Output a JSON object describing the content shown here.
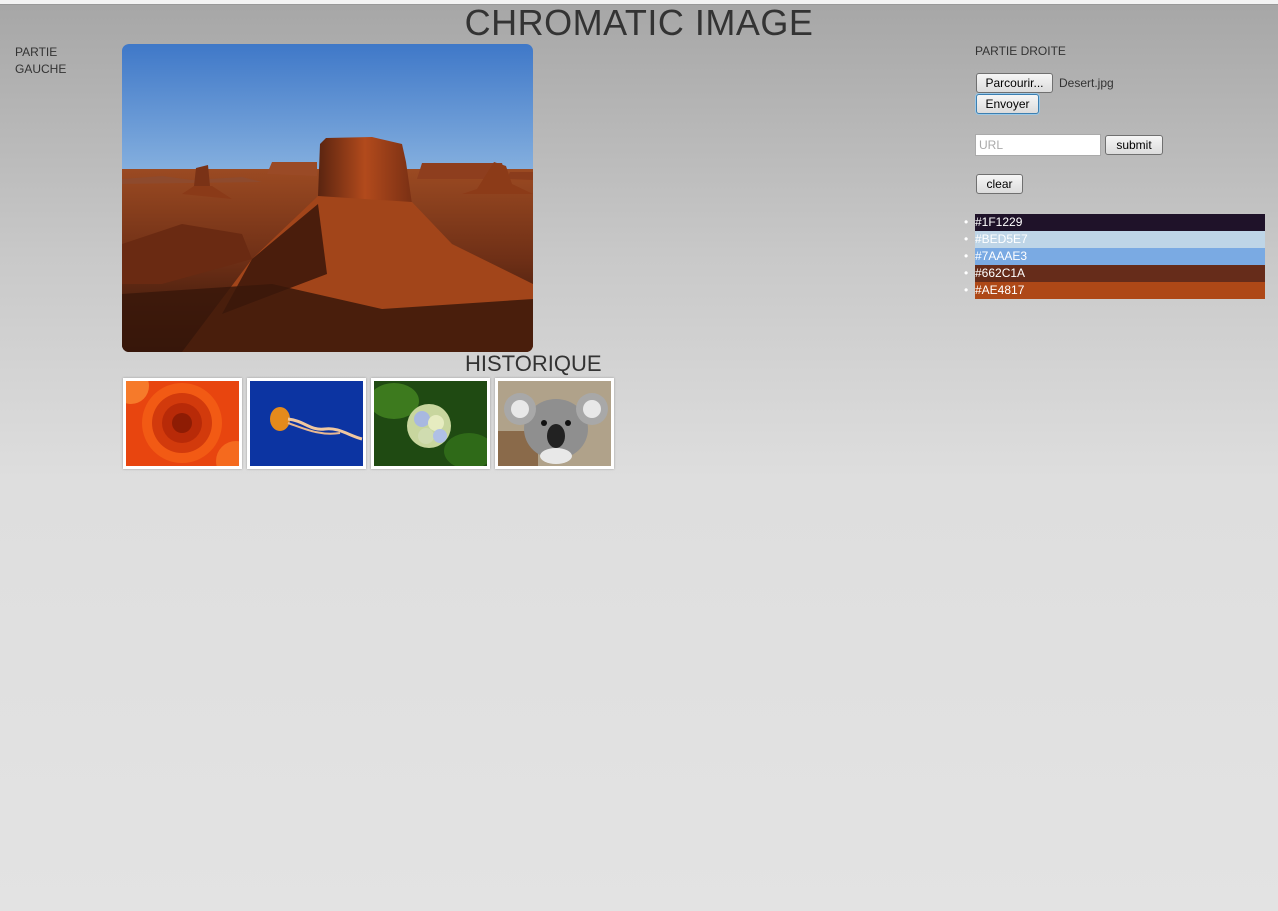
{
  "header": {
    "title": "CHROMATIC IMAGE"
  },
  "left_panel": {
    "label": "PARTIE GAUCHE"
  },
  "right_panel": {
    "label": "PARTIE DROITE",
    "browse_label": "Parcourir...",
    "file_name": "Desert.jpg",
    "send_label": "Envoyer",
    "url_placeholder": "URL",
    "url_value": "",
    "submit_label": "submit",
    "clear_label": "clear"
  },
  "palette": [
    {
      "hex": "#1F1229",
      "color": "#1F1229"
    },
    {
      "hex": "#BED5E7",
      "color": "#BED5E7"
    },
    {
      "hex": "#7AAAE3",
      "color": "#7AAAE3"
    },
    {
      "hex": "#662C1A",
      "color": "#662C1A"
    },
    {
      "hex": "#AE4817",
      "color": "#AE4817"
    }
  ],
  "history": {
    "title": "HISTORIQUE",
    "images": [
      {
        "subject": "orange chrysanthemum flower"
      },
      {
        "subject": "jellyfish"
      },
      {
        "subject": "hydrangea flower"
      },
      {
        "subject": "koala"
      }
    ]
  }
}
